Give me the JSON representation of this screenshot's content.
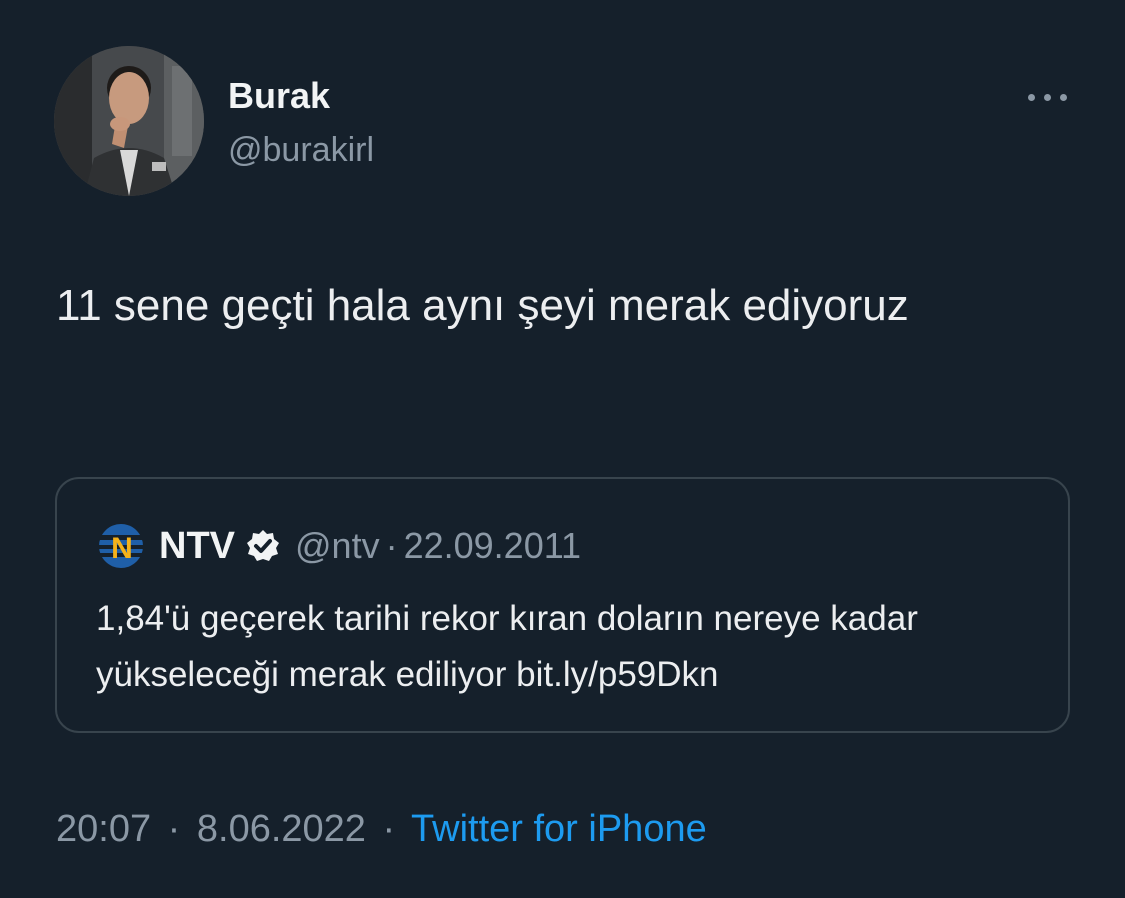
{
  "author": {
    "display_name": "Burak",
    "handle": "@burakirl"
  },
  "tweet": {
    "text": "11 sene geçti hala aynı şeyi merak ediyoruz",
    "time": "20:07",
    "separator": "·",
    "date": "8.06.2022",
    "source": "Twitter for iPhone"
  },
  "quoted_tweet": {
    "author_name": "NTV",
    "handle": "@ntv",
    "separator": "·",
    "date": "22.09.2011",
    "text": "1,84'ü geçerek tarihi rekor kıran doların nereye kadar yükseleceği merak ediliyor bit.ly/p59Dkn",
    "logo_letter": "N"
  },
  "icons": {
    "more": "more-horizontal-icon",
    "verified": "verified-badge-icon",
    "ntv_logo": "ntv-logo-icon"
  },
  "colors": {
    "background": "#15202b",
    "text": "#e7e9ea",
    "secondary": "#8b98a5",
    "link": "#1d9bf0",
    "border": "#38444d"
  }
}
